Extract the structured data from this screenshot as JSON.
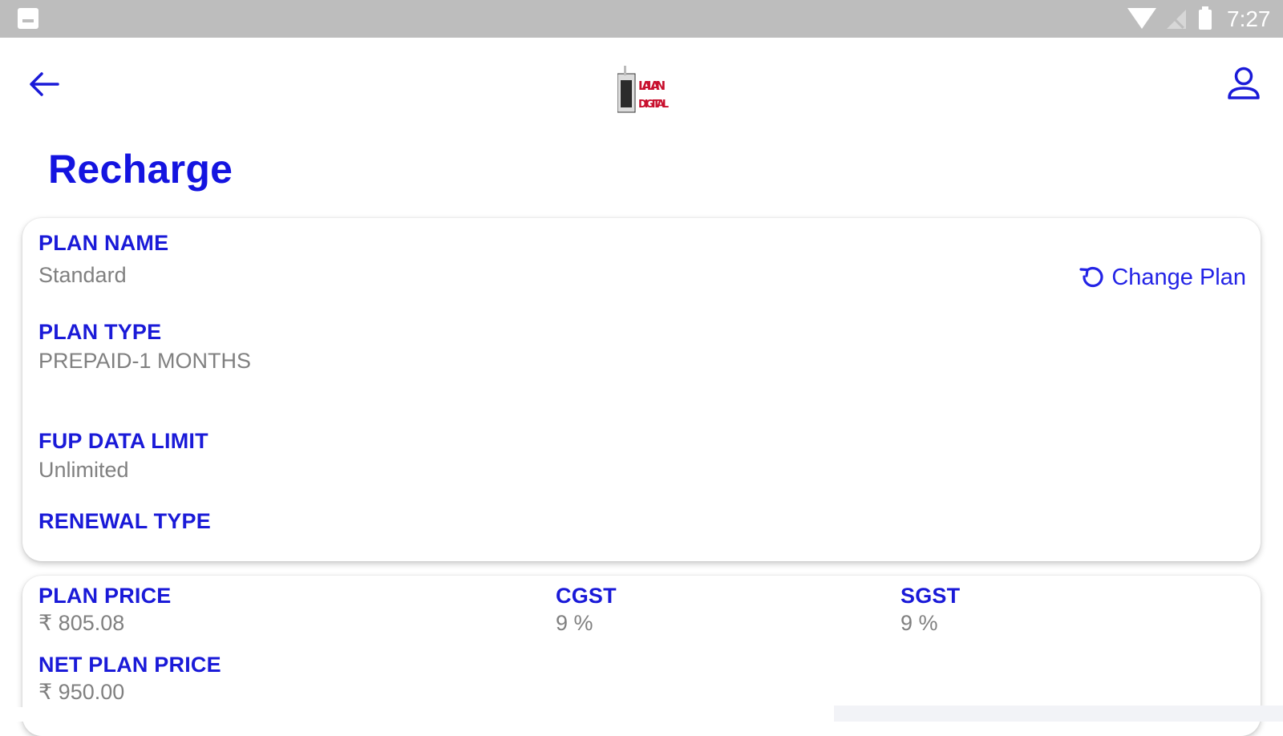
{
  "status_bar": {
    "time": "7:27",
    "icons": [
      "image-icon",
      "wifi-icon",
      "no-signal-icon",
      "battery-icon"
    ]
  },
  "header": {
    "back_icon": "arrow-left-icon",
    "logo_text_line1": "LALAN",
    "logo_text_line2": "DIGITAL",
    "profile_icon": "person-icon"
  },
  "page": {
    "title": "Recharge"
  },
  "plan_card": {
    "plan_name_label": "PLAN NAME",
    "plan_name_value": "Standard",
    "change_plan_label": "Change Plan",
    "plan_type_label": "PLAN TYPE",
    "plan_type_value": "PREPAID-1 MONTHS",
    "fup_label": "FUP DATA LIMIT",
    "fup_value": "Unlimited",
    "renewal_label": "RENEWAL TYPE"
  },
  "price_card": {
    "plan_price_label": "PLAN PRICE",
    "plan_price_value": "₹ 805.08",
    "cgst_label": "CGST",
    "cgst_value": "9 %",
    "sgst_label": "SGST",
    "sgst_value": "9 %",
    "net_price_label": "NET PLAN PRICE",
    "net_price_value": "₹ 950.00"
  },
  "colors": {
    "accent": "#1414e0",
    "value_gray": "#808080",
    "status_bar": "#bdbdbd"
  }
}
